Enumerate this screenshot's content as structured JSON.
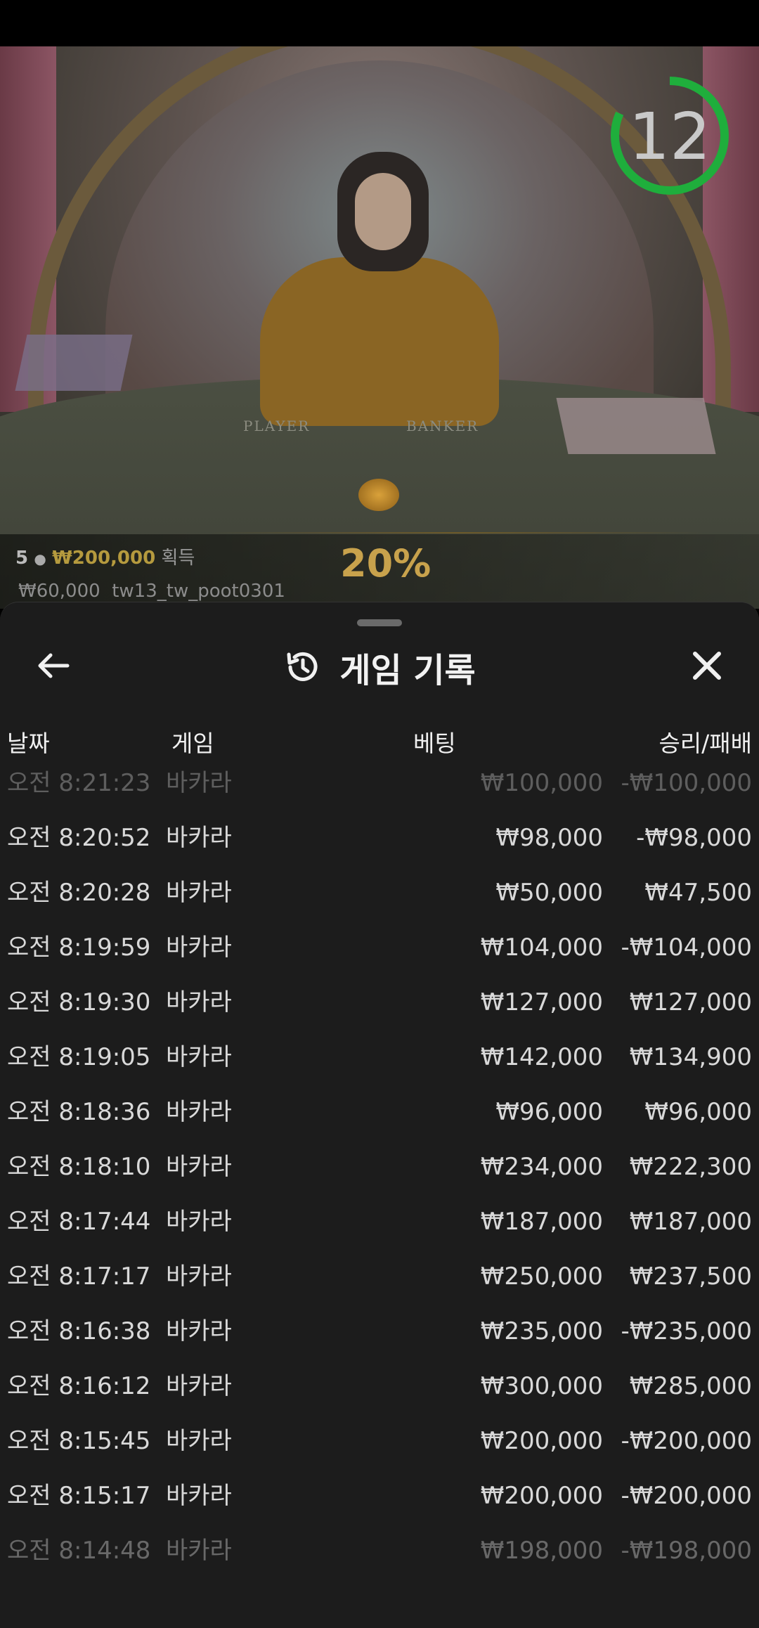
{
  "live_table": {
    "timer_seconds": "12",
    "table_labels": {
      "player": "PLAYER",
      "banker": "BANKER"
    },
    "winners": {
      "count": "5",
      "amount": "₩200,000",
      "suffix": "획득",
      "sub_amount": "₩60,000",
      "sub_user": "tw13_tw_poot0301"
    },
    "promo_percent": "20%",
    "colors": {
      "timer_ring": "#1fae3c",
      "gold": "#b59a3e"
    }
  },
  "history_sheet": {
    "title": "게임 기록",
    "icons": {
      "back": "arrow-left-icon",
      "history": "history-clock-icon",
      "close": "close-icon"
    },
    "columns": {
      "date": "날짜",
      "game": "게임",
      "bet": "베팅",
      "result": "승리/패배"
    },
    "rows": [
      {
        "date": "오전 8:21:23",
        "game": "바카라",
        "bet": "₩100,000",
        "result": "-₩100,000"
      },
      {
        "date": "오전 8:20:52",
        "game": "바카라",
        "bet": "₩98,000",
        "result": "-₩98,000"
      },
      {
        "date": "오전 8:20:28",
        "game": "바카라",
        "bet": "₩50,000",
        "result": "₩47,500"
      },
      {
        "date": "오전 8:19:59",
        "game": "바카라",
        "bet": "₩104,000",
        "result": "-₩104,000"
      },
      {
        "date": "오전 8:19:30",
        "game": "바카라",
        "bet": "₩127,000",
        "result": "₩127,000"
      },
      {
        "date": "오전 8:19:05",
        "game": "바카라",
        "bet": "₩142,000",
        "result": "₩134,900"
      },
      {
        "date": "오전 8:18:36",
        "game": "바카라",
        "bet": "₩96,000",
        "result": "₩96,000"
      },
      {
        "date": "오전 8:18:10",
        "game": "바카라",
        "bet": "₩234,000",
        "result": "₩222,300"
      },
      {
        "date": "오전 8:17:44",
        "game": "바카라",
        "bet": "₩187,000",
        "result": "₩187,000"
      },
      {
        "date": "오전 8:17:17",
        "game": "바카라",
        "bet": "₩250,000",
        "result": "₩237,500"
      },
      {
        "date": "오전 8:16:38",
        "game": "바카라",
        "bet": "₩235,000",
        "result": "-₩235,000"
      },
      {
        "date": "오전 8:16:12",
        "game": "바카라",
        "bet": "₩300,000",
        "result": "₩285,000"
      },
      {
        "date": "오전 8:15:45",
        "game": "바카라",
        "bet": "₩200,000",
        "result": "-₩200,000"
      },
      {
        "date": "오전 8:15:17",
        "game": "바카라",
        "bet": "₩200,000",
        "result": "-₩200,000"
      },
      {
        "date": "오전 8:14:48",
        "game": "바카라",
        "bet": "₩198,000",
        "result": "-₩198,000"
      }
    ]
  }
}
